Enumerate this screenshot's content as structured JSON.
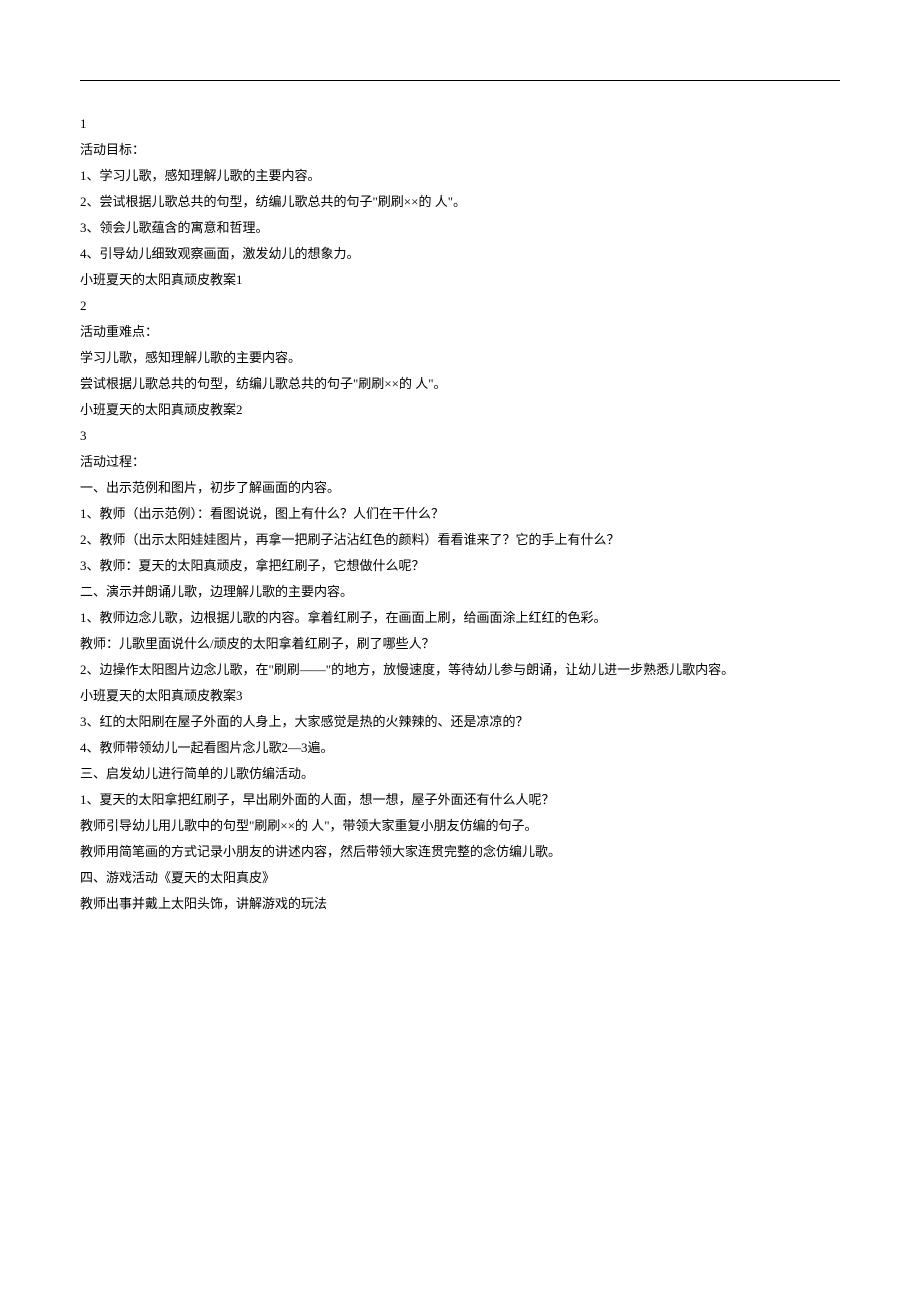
{
  "sections": [
    {
      "num": "1",
      "title": "活动目标："
    },
    {
      "num": "2",
      "title": "活动重难点："
    },
    {
      "num": "3",
      "title": "活动过程："
    }
  ],
  "s1": {
    "l1": "1、学习儿歌，感知理解儿歌的主要内容。",
    "l2": "2、尝试根据儿歌总共的句型，纺编儿歌总共的句子\"刷刷××的  人\"。",
    "l3": "3、领会儿歌蕴含的寓意和哲理。",
    "l4": "4、引导幼儿细致观察画面，激发幼儿的想象力。",
    "l5": "小班夏天的太阳真顽皮教案1"
  },
  "s2": {
    "l1": "学习儿歌，感知理解儿歌的主要内容。",
    "l2": "尝试根据儿歌总共的句型，纺编儿歌总共的句子\"刷刷××的  人\"。",
    "l3": "小班夏天的太阳真顽皮教案2"
  },
  "s3": {
    "h1": "一、出示范例和图片，初步了解画面的内容。",
    "h1_1": "1、教师（出示范例）：看图说说，图上有什么？人们在干什么？",
    "h1_2": "2、教师（出示太阳娃娃图片，再拿一把刷子沾沾红色的颜料）看看谁来了？它的手上有什么？",
    "h1_3": "3、教师：夏天的太阳真顽皮，拿把红刷子，它想做什么呢？",
    "h2": "二、演示并朗诵儿歌，边理解儿歌的主要内容。",
    "h2_1": "1、教师边念儿歌，边根据儿歌的内容。拿着红刷子，在画面上刷，给画面涂上红红的色彩。",
    "h2_1b": "教师：儿歌里面说什么/顽皮的太阳拿着红刷子，刷了哪些人？",
    "h2_2": "2、边操作太阳图片边念儿歌，在\"刷刷——\"的地方，放慢速度，等待幼儿参与朗诵，让幼儿进一步熟悉儿歌内容。",
    "h2_2b": "小班夏天的太阳真顽皮教案3",
    "h2_3": "3、红的太阳刷在屋子外面的人身上，大家感觉是热的火辣辣的、还是凉凉的？",
    "h2_4": "4、教师带领幼儿一起看图片念儿歌2—3遍。",
    "h3": "三、启发幼儿进行简单的儿歌仿编活动。",
    "h3_1": "1、夏天的太阳拿把红刷子，早出刷外面的人面，想一想，屋子外面还有什么人呢？",
    "h3_1b": "教师引导幼儿用儿歌中的句型\"刷刷××的  人\"，带领大家重复小朋友仿编的句子。",
    "h3_1c": "教师用简笔画的方式记录小朋友的讲述内容，然后带领大家连贯完整的念仿编儿歌。",
    "h4": "四、游戏活动《夏天的太阳真皮》",
    "h4_1": "教师出事并戴上太阳头饰，讲解游戏的玩法"
  }
}
